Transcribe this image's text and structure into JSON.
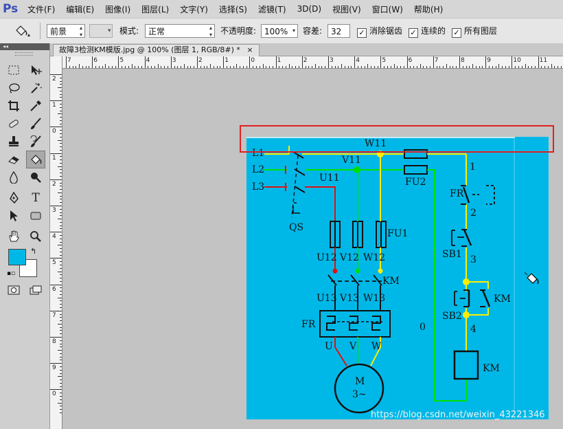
{
  "menubar": {
    "logo": "Ps",
    "items": [
      "文件(F)",
      "编辑(E)",
      "图像(I)",
      "图层(L)",
      "文字(Y)",
      "选择(S)",
      "滤镜(T)",
      "3D(D)",
      "视图(V)",
      "窗口(W)",
      "帮助(H)"
    ]
  },
  "options": {
    "fill_source": "前景",
    "mode_label": "模式:",
    "mode_value": "正常",
    "opacity_label": "不透明度:",
    "opacity_value": "100%",
    "tolerance_label": "容差:",
    "tolerance_value": "32",
    "antialias_label": "消除锯齿",
    "contiguous_label": "连续的",
    "all_layers_label": "所有图层",
    "check_mark": "✓"
  },
  "toolbar": {
    "collapse": "◂◂",
    "foreground_color": "#00b8e8",
    "background_color": "#ffffff"
  },
  "document": {
    "tab_title": "故障3检测KM模版.jpg @ 100% (图层 1, RGB/8#) *",
    "close_glyph": "×",
    "ruler_h": [
      "7",
      "6",
      "5",
      "4",
      "3",
      "2",
      "1",
      "0",
      "1",
      "2",
      "3",
      "4",
      "5",
      "6",
      "7",
      "8",
      "9",
      "10",
      "11"
    ],
    "ruler_v": [
      "2",
      "1",
      "0",
      "1",
      "2",
      "3",
      "4",
      "5",
      "6",
      "7",
      "8",
      "9",
      "0"
    ]
  },
  "diagram": {
    "labels": {
      "L1": "L1",
      "L2": "L2",
      "L3": "L3",
      "W11": "W11",
      "V11": "V11",
      "U11": "U11",
      "QS": "QS",
      "FU1": "FU1",
      "FU2": "FU2",
      "U12": "U12",
      "V12": "V12",
      "W12": "W12",
      "U13": "U13",
      "V13": "V13",
      "W13": "W13",
      "KM_contact": "KM",
      "KM_hold": "KM",
      "KM_coil": "KM",
      "FR_left": "FR",
      "FR_right": "FR",
      "U": "U",
      "V": "V",
      "W": "W",
      "motor_M": "M",
      "motor_3": "3~",
      "SB1": "SB1",
      "SB2": "SB2",
      "n1": "1",
      "n2": "2",
      "n3": "3",
      "n4": "4",
      "n0": "0"
    }
  },
  "watermark": "https://blog.csdn.net/weixin_43221346"
}
